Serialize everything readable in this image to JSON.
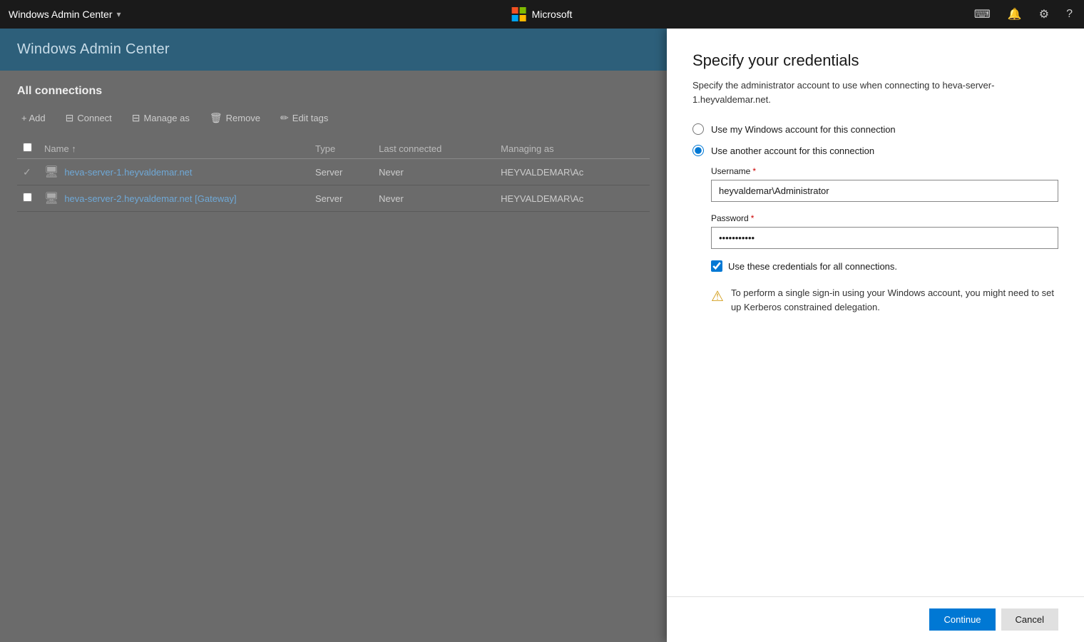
{
  "topbar": {
    "app_title": "Windows Admin Center",
    "chevron": "▾",
    "microsoft_label": "Microsoft",
    "terminal_icon": "⌨",
    "bell_icon": "🔔",
    "gear_icon": "⚙",
    "help_icon": "?"
  },
  "left_panel": {
    "wac_header": "Windows Admin Center",
    "section_title": "All connections",
    "toolbar": {
      "add": "+ Add",
      "connect": "Connect",
      "manage_as": "Manage as",
      "remove": "Remove",
      "edit_tags": "Edit tags"
    },
    "table": {
      "columns": [
        "Name",
        "Type",
        "Last connected",
        "Managing as"
      ],
      "rows": [
        {
          "checked": true,
          "name": "heva-server-1.heyvaldemar.net",
          "type": "Server",
          "last_connected": "Never",
          "managing_as": "HEYVALDEMAR\\Ac"
        },
        {
          "checked": false,
          "name": "heva-server-2.heyvaldemar.net [Gateway]",
          "type": "Server",
          "last_connected": "Never",
          "managing_as": "HEYVALDEMAR\\Ac"
        }
      ]
    }
  },
  "dialog": {
    "title": "Specify your credentials",
    "description": "Specify the administrator account to use when connecting to heva-server-1.heyvaldemar.net.",
    "radio_option_1": "Use my Windows account for this connection",
    "radio_option_2": "Use another account for this connection",
    "username_label": "Username",
    "required_star": "*",
    "username_value": "heyvaldemar\\Administrator",
    "password_label": "Password",
    "password_value": "••••••••••",
    "checkbox_label": "Use these credentials for all connections.",
    "checkbox_checked": true,
    "warning_text": "To perform a single sign-in using your Windows account, you might need to set up Kerberos constrained delegation.",
    "continue_btn": "Continue",
    "cancel_btn": "Cancel"
  },
  "colors": {
    "accent_blue": "#0078d4",
    "wac_header_bg": "#2d5f7a",
    "link_color": "#6fa8d6",
    "warning_color": "#d4a020"
  }
}
